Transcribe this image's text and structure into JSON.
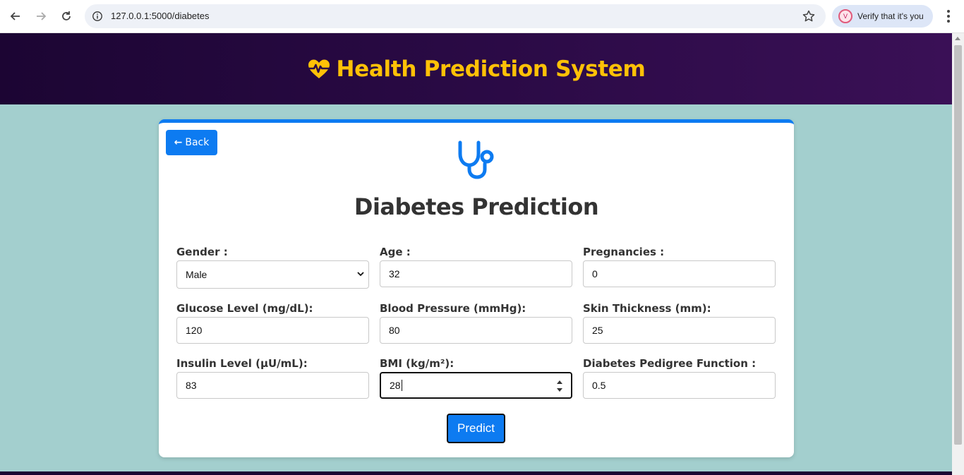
{
  "browser": {
    "url": "127.0.0.1:5000/diabetes",
    "verify_label": "Verify that it's you",
    "avatar_letter": "V"
  },
  "header": {
    "title": "Health Prediction System",
    "title_color": "#ffc107",
    "icon": "heart-pulse-icon"
  },
  "card": {
    "back_label": "Back",
    "title": "Diabetes Prediction",
    "icon": "stethoscope-icon",
    "accent": "#0d7bf1",
    "fields": {
      "gender": {
        "label": "Gender :",
        "value": "Male"
      },
      "age": {
        "label": "Age :",
        "value": "32"
      },
      "pregnancies": {
        "label": "Pregnancies :",
        "value": "0"
      },
      "glucose": {
        "label": "Glucose Level (mg/dL):",
        "value": "120"
      },
      "blood_pressure": {
        "label": "Blood Pressure (mmHg):",
        "value": "80"
      },
      "skin_thickness": {
        "label": "Skin Thickness (mm):",
        "value": "25"
      },
      "insulin": {
        "label": "Insulin Level (µU/mL):",
        "value": "83"
      },
      "bmi": {
        "label": "BMI (kg/m²):",
        "value": "28"
      },
      "pedigree": {
        "label": "Diabetes Pedigree Function :",
        "value": "0.5"
      }
    },
    "predict_label": "Predict"
  }
}
